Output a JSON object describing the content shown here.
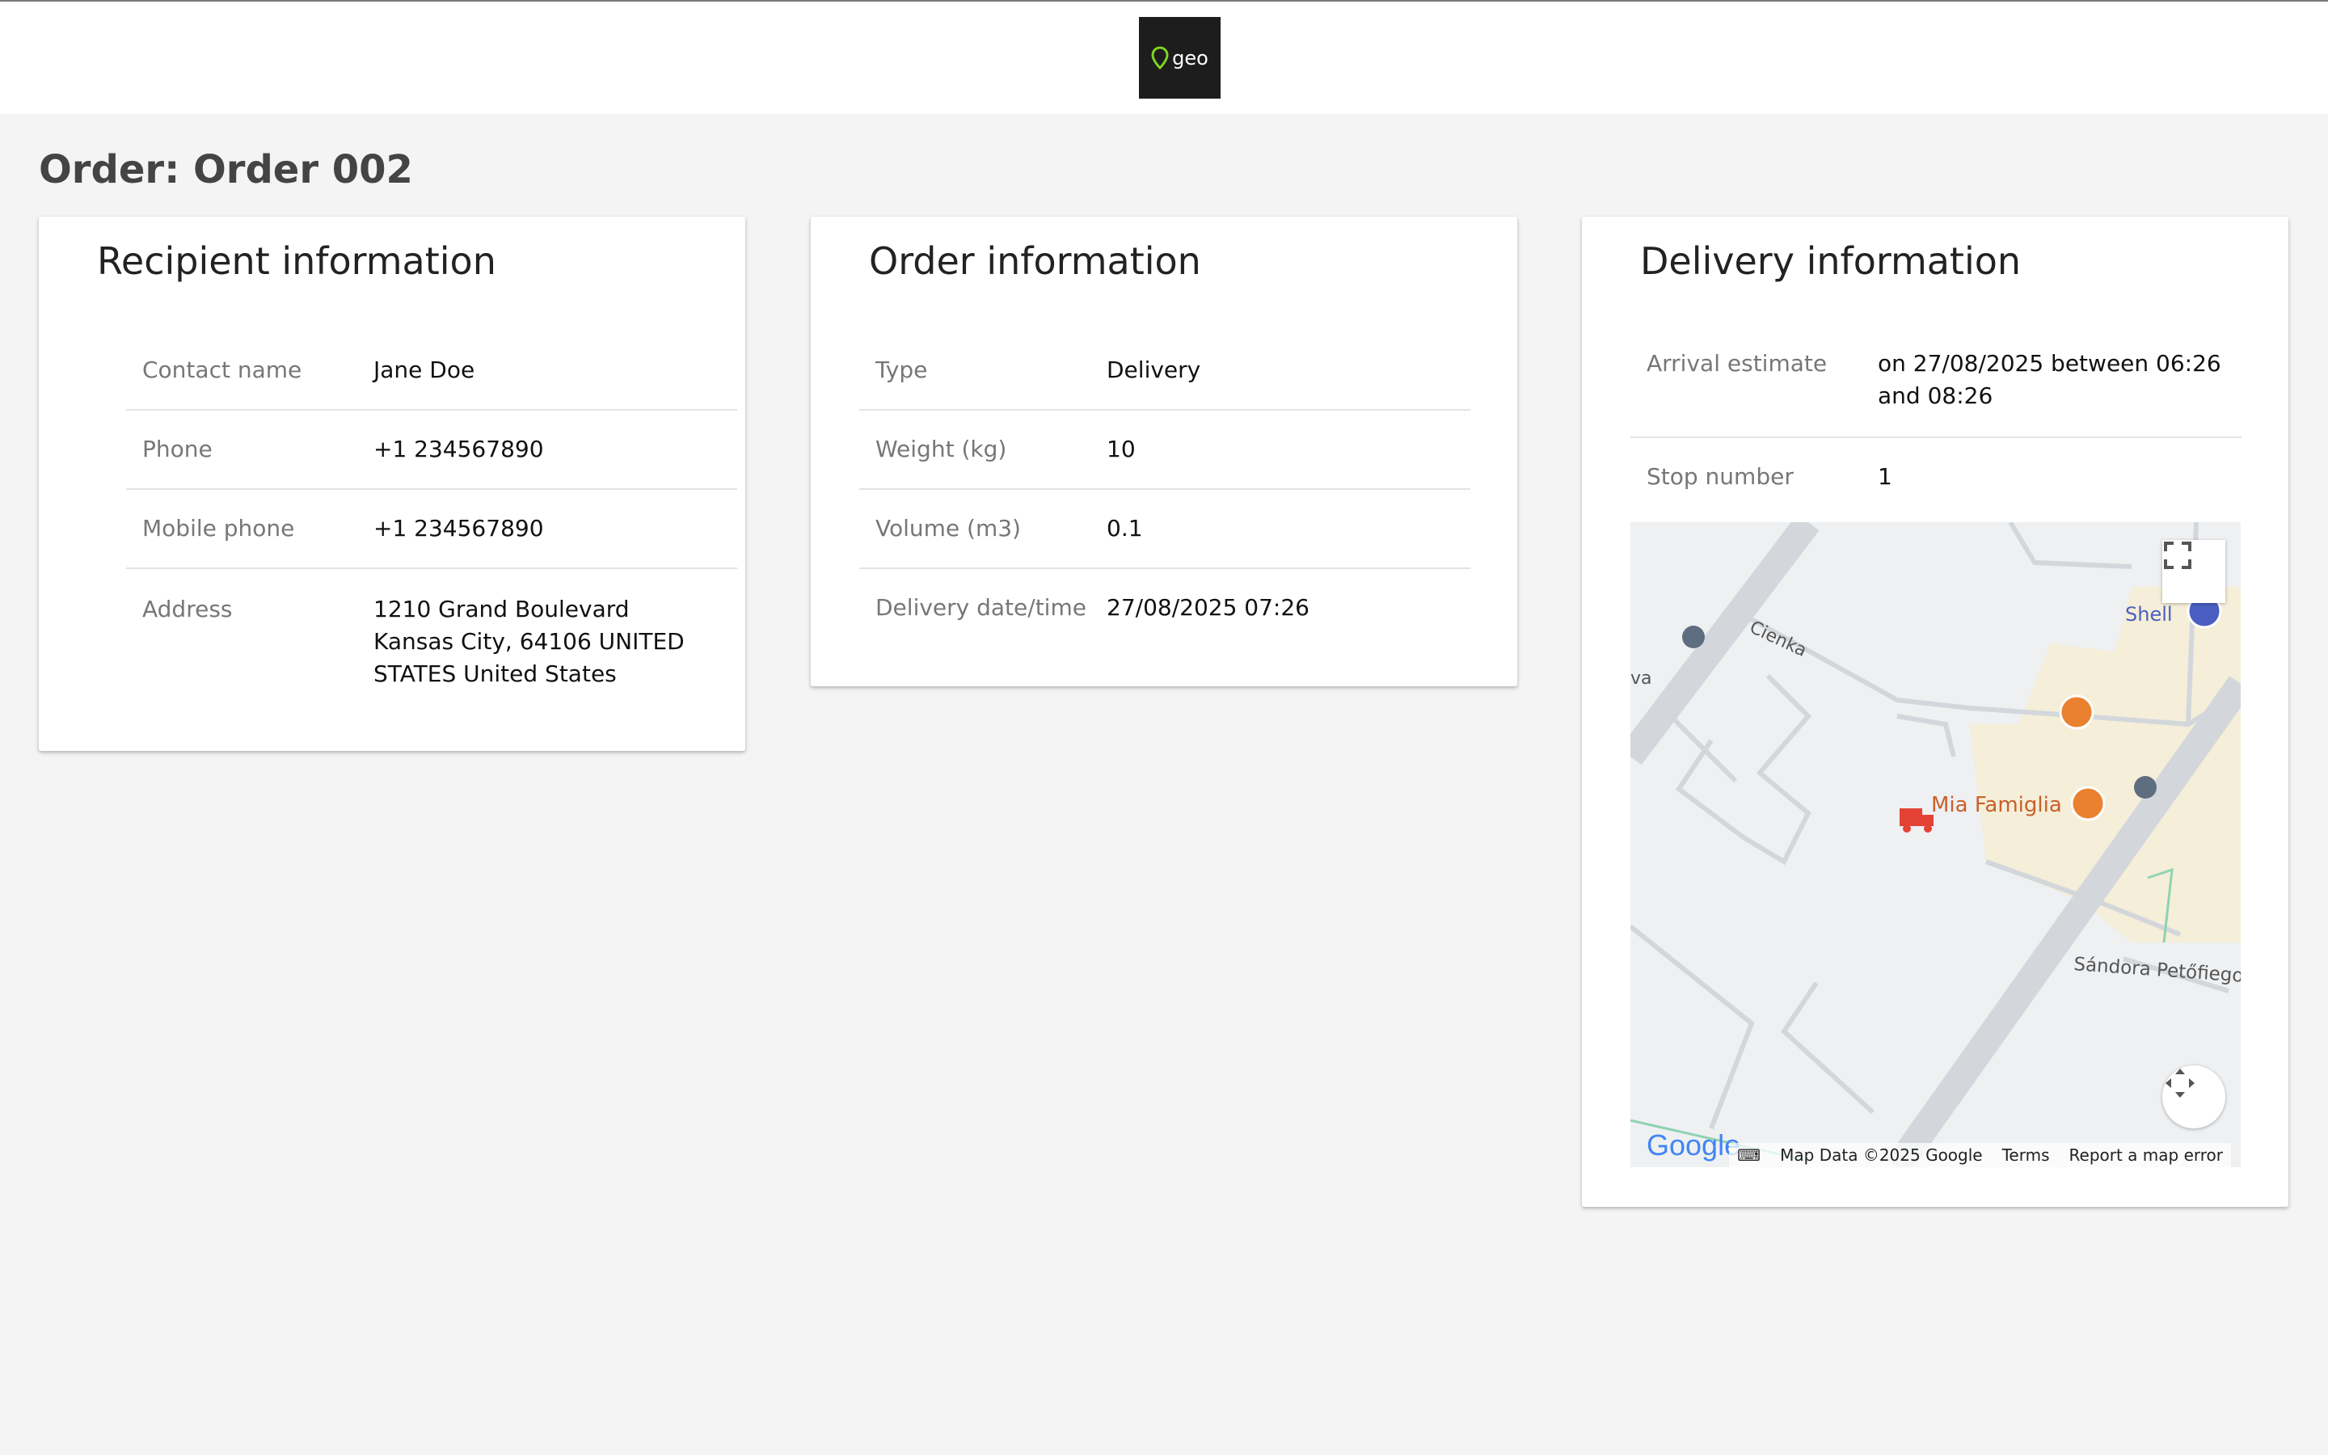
{
  "header": {
    "logo_text": "geo"
  },
  "page": {
    "title": "Order: Order 002"
  },
  "recipient": {
    "title": "Recipient information",
    "rows": [
      {
        "label": "Contact name",
        "value": "Jane Doe"
      },
      {
        "label": "Phone",
        "value": "+1 234567890"
      },
      {
        "label": "Mobile phone",
        "value": "+1 234567890"
      },
      {
        "label": "Address",
        "value": "1210 Grand Boulevard Kansas City, 64106 UNITED STATES United States"
      }
    ]
  },
  "order": {
    "title": "Order information",
    "rows": [
      {
        "label": "Type",
        "value": "Delivery"
      },
      {
        "label": "Weight (kg)",
        "value": "10"
      },
      {
        "label": "Volume (m3)",
        "value": "0.1"
      },
      {
        "label": "Delivery date/time",
        "value": "27/08/2025 07:26"
      }
    ]
  },
  "delivery": {
    "title": "Delivery information",
    "rows": [
      {
        "label": "Arrival estimate",
        "value": "on 27/08/2025 between 06:26 and 08:26"
      },
      {
        "label": "Stop number",
        "value": "1"
      }
    ]
  },
  "map": {
    "labels": {
      "shell": "Shell",
      "cienka": "Cienka",
      "restaurant": "Mia Famiglia",
      "street": "Sándora Petőfiego",
      "edge": "va"
    },
    "footer": {
      "google": "Google",
      "map_data": "Map Data ©2025 Google",
      "terms": "Terms",
      "report": "Report a map error"
    },
    "colors": {
      "road": "#d3d7dc",
      "area": "#f5eed8",
      "poi": "#e9812f",
      "vehicle": "#e34234",
      "shell": "#4a5fc1"
    }
  }
}
